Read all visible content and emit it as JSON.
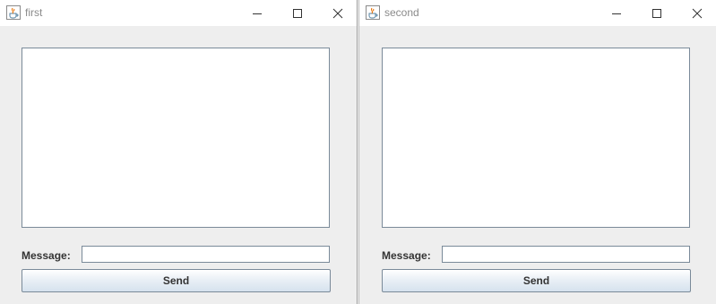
{
  "windows": [
    {
      "title": "first",
      "message_label": "Message:",
      "message_value": "",
      "send_label": "Send",
      "chat_text": ""
    },
    {
      "title": "second",
      "message_label": "Message:",
      "message_value": "",
      "send_label": "Send",
      "chat_text": ""
    }
  ],
  "titlebar_buttons": [
    "minimize",
    "maximize",
    "close"
  ],
  "icons": {
    "app": "java-coffee-cup-icon",
    "minimize": "minimize-icon",
    "maximize": "maximize-icon",
    "close": "close-icon"
  },
  "colors": {
    "window_bg": "#eeeeee",
    "titlebar_bg": "#ffffff",
    "title_text": "#8a8a8a",
    "border": "#7a8a99",
    "button_gradient_bottom": "#d6e2ee"
  }
}
